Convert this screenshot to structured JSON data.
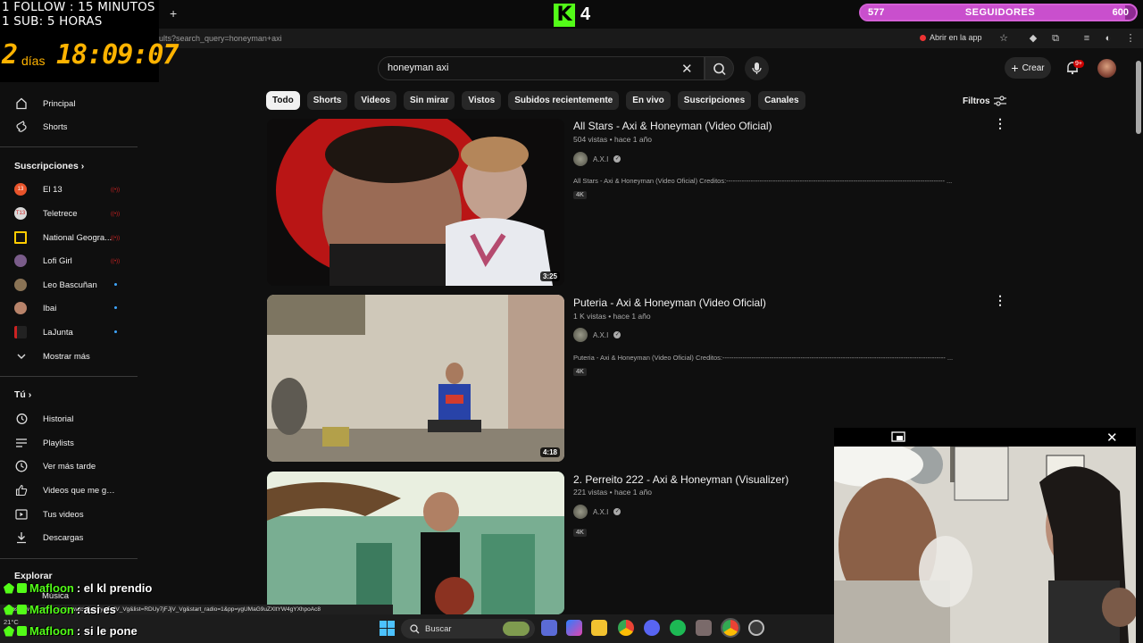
{
  "browser": {
    "url": "ults?search_query=honeyman+axi",
    "new_tab": "+",
    "open_in_app": "Abrir en la app"
  },
  "overlay": {
    "follow_line": "1 FOLLOW : 15 MINUTOS",
    "sub_line": "1 SUB: 5 HORAS",
    "days_num": "2",
    "days_label": "días",
    "clock": "18:09:07",
    "kick_logo": "K",
    "kick_num": "4",
    "followers": {
      "current": "577",
      "label": "SEGUIDORES",
      "goal": "600",
      "progress": 0.9617
    }
  },
  "header": {
    "search_value": "honeyman axi",
    "create_label": "Crear",
    "notif_count": "9+"
  },
  "chips": [
    "Todo",
    "Shorts",
    "Videos",
    "Sin mirar",
    "Vistos",
    "Subidos recientemente",
    "En vivo",
    "Suscripciones",
    "Canales"
  ],
  "filters_label": "Filtros",
  "sidebar": {
    "main": [
      {
        "label": "Principal",
        "icon": "home-icon"
      },
      {
        "label": "Shorts",
        "icon": "shorts-icon"
      }
    ],
    "subs_header": "Suscripciones",
    "subs": [
      {
        "label": "El 13",
        "status": "live",
        "color": "#e8542b",
        "initial": "13"
      },
      {
        "label": "Teletrece",
        "status": "live",
        "color": "#d9d9d9",
        "initial": "T13"
      },
      {
        "label": "National Geogra...",
        "status": "live",
        "color": "#ffcc00",
        "initial": ""
      },
      {
        "label": "Lofi Girl",
        "status": "live",
        "color": "#7a5c8a",
        "initial": ""
      },
      {
        "label": "Leo Bascuñan",
        "status": "new",
        "color": "#8a7355",
        "initial": ""
      },
      {
        "label": "Ibai",
        "status": "new",
        "color": "#b8836a",
        "initial": ""
      },
      {
        "label": "LaJunta",
        "status": "new",
        "color": "#222222",
        "initial": ""
      }
    ],
    "show_more": "Mostrar más",
    "you_header": "Tú",
    "you": [
      {
        "label": "Historial",
        "icon": "history-icon"
      },
      {
        "label": "Playlists",
        "icon": "playlists-icon"
      },
      {
        "label": "Ver más tarde",
        "icon": "clock-icon"
      },
      {
        "label": "Videos que me gus...",
        "icon": "thumbs-up-icon"
      },
      {
        "label": "Tus videos",
        "icon": "play-square-icon"
      },
      {
        "label": "Descargas",
        "icon": "download-icon"
      }
    ],
    "explore_header": "Explorar",
    "music": "Música"
  },
  "results": [
    {
      "title": "All Stars - Axi & Honeyman (Video Oficial)",
      "meta": "504 vistas • hace 1 año",
      "channel": "A.X.I",
      "desc": "All Stars - Axi & Honeyman (Video Oficial) Creditos:-------------------------------------------------------------------------------------------------- ...",
      "badge": "4K",
      "duration": "3:25"
    },
    {
      "title": "Puteria - Axi & Honeyman (Video Oficial)",
      "meta": "1 K vistas • hace 1 año",
      "channel": "A.X.I",
      "desc": "Puteria - Axi & Honeyman (Video Oficial) Creditos:---------------------------------------------------------------------------------------------------- ...",
      "badge": "4K",
      "duration": "4:18"
    },
    {
      "title": "2. Perreito 222 - Axi & Honeyman (Visualizer)",
      "meta": "221 vistas • hace 1 año",
      "channel": "A.X.I",
      "desc": "",
      "badge": "4K",
      "duration": ""
    }
  ],
  "chat": [
    {
      "user": "Mafloon",
      "text": ": el kl prendio"
    },
    {
      "user": "Mafloon",
      "text": ": asi es"
    },
    {
      "user": "Mafloon",
      "text": ": si le pone"
    }
  ],
  "taskbar": {
    "status_url": "https://www.youtube.com/watch?v=Uy7jFJjV_Vg&list=RDUy7jFJjV_Vg&start_radio=1&pp=ygUMaG9uZXltYW4gYXhpoAc8",
    "search": "Buscar",
    "weather": "21°C"
  }
}
